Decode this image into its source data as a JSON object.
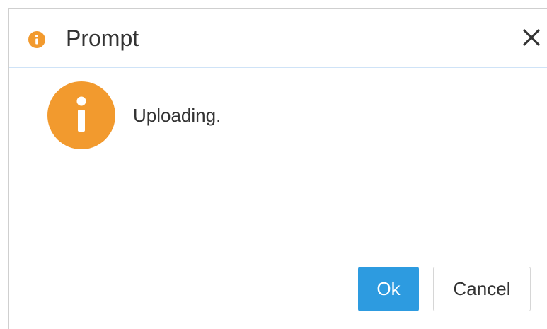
{
  "dialog": {
    "title": "Prompt",
    "title_icon": "info-icon",
    "close_icon": "close-icon",
    "message": "Uploading.",
    "message_icon": "info-icon",
    "ok_label": "Ok",
    "cancel_label": "Cancel"
  },
  "colors": {
    "info_orange": "#f29a2e",
    "primary_blue": "#2d9be0",
    "header_divider": "#cfe3f7",
    "text": "#333333"
  }
}
